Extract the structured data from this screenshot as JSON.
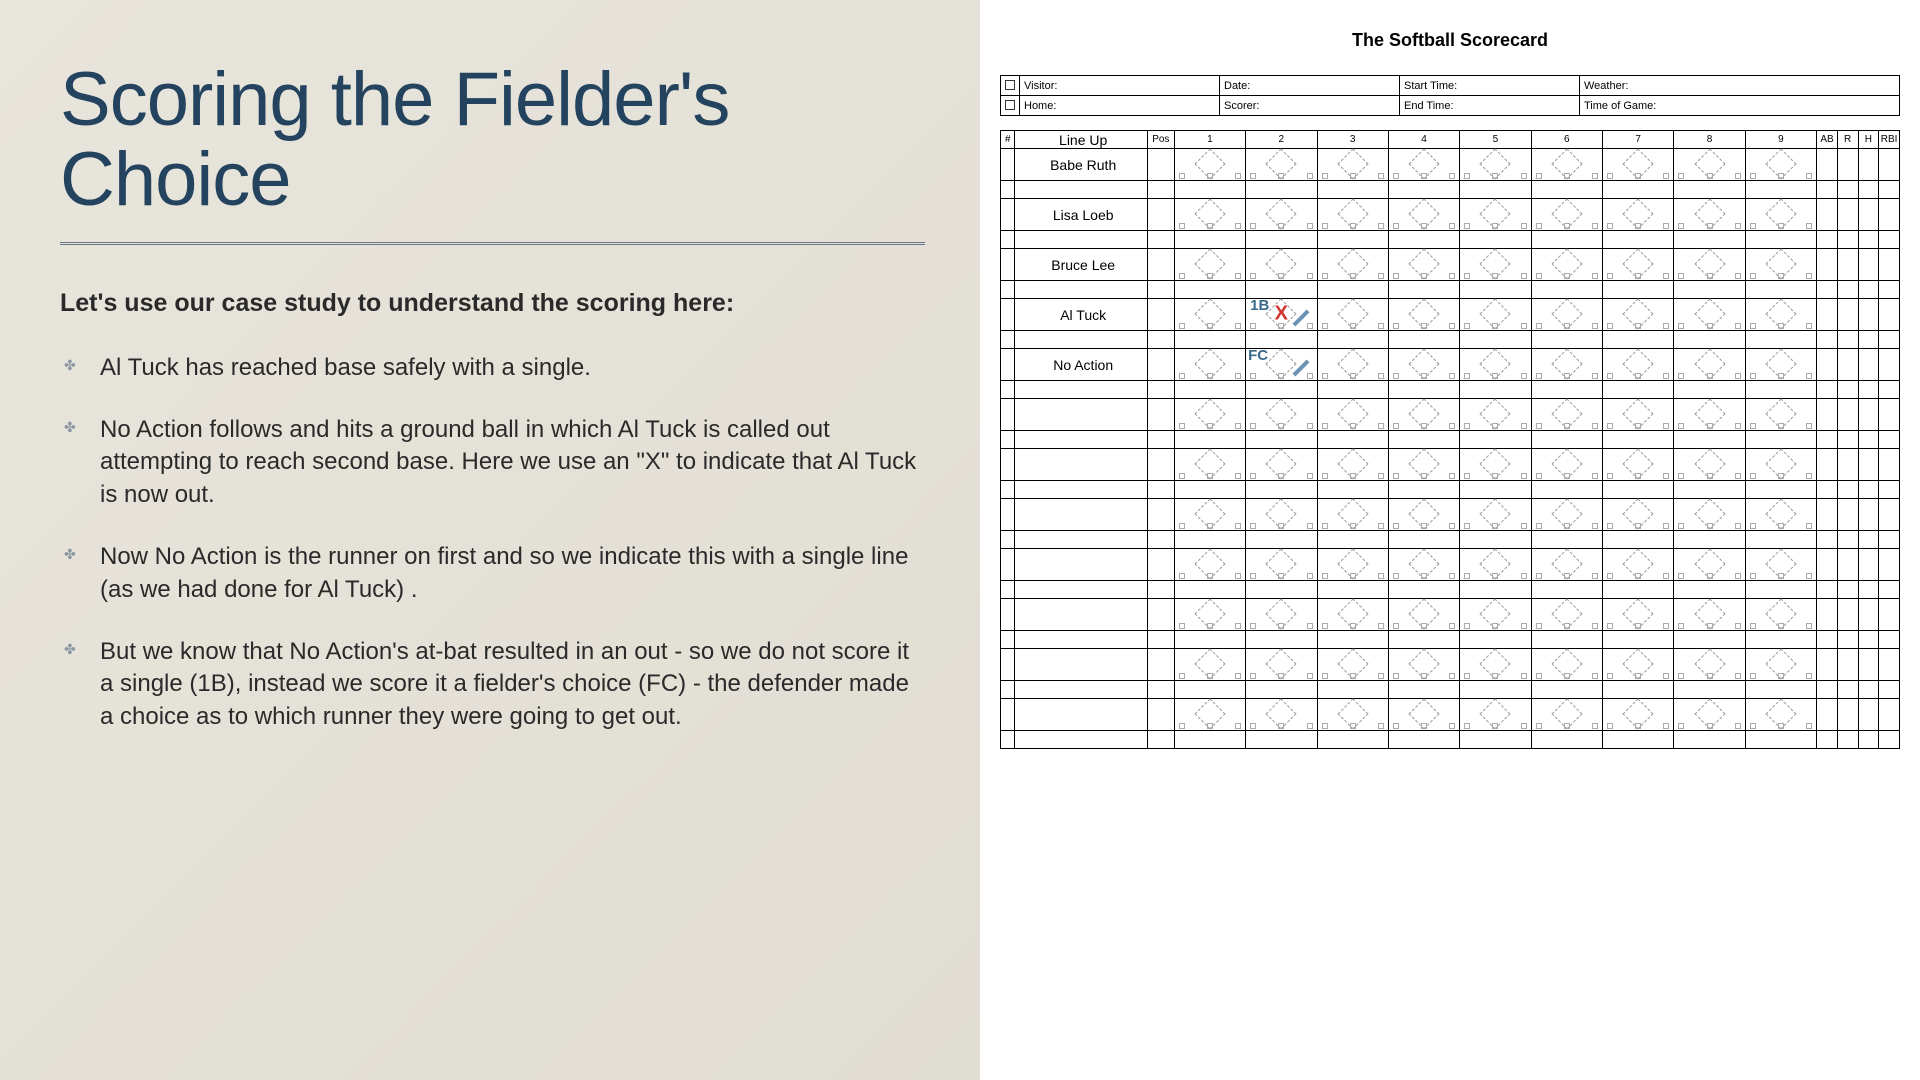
{
  "title": "Scoring the Fielder's Choice",
  "subtitle": "Let's use our case study to understand the scoring here:",
  "bullets": [
    "Al Tuck has reached base safely with a single.",
    "No Action follows and hits a ground ball in which Al Tuck is called out attempting to reach second base. Here we use an \"X\" to indicate that Al Tuck is now out.",
    "Now No Action is the runner on first and so we indicate this with a single line (as we had done for Al Tuck) .",
    "But we know that No Action's at-bat resulted in an out - so we do not score it a single (1B), instead we score it a fielder's choice (FC) - the defender made a choice as to which runner they were going to get out."
  ],
  "scorecard": {
    "title": "The Softball Scorecard",
    "info": {
      "visitor": "Visitor:",
      "home": "Home:",
      "date": "Date:",
      "scorer": "Scorer:",
      "start_time": "Start Time:",
      "end_time": "End Time:",
      "weather": "Weather:",
      "time_of_game": "Time of Game:"
    },
    "headers": {
      "num": "#",
      "lineup": "Line Up",
      "pos": "Pos",
      "innings": [
        "1",
        "2",
        "3",
        "4",
        "5",
        "6",
        "7",
        "8",
        "9"
      ],
      "stats": [
        "AB",
        "R",
        "H",
        "RBI"
      ]
    },
    "players": [
      "Babe Ruth",
      "Lisa Loeb",
      "Bruce Lee",
      "Al Tuck",
      "No Action",
      "",
      "",
      "",
      "",
      "",
      "",
      ""
    ],
    "annotations": {
      "al_tuck_inning2": {
        "label": "1B",
        "out": "X"
      },
      "no_action_inning2": {
        "label": "FC"
      }
    }
  }
}
